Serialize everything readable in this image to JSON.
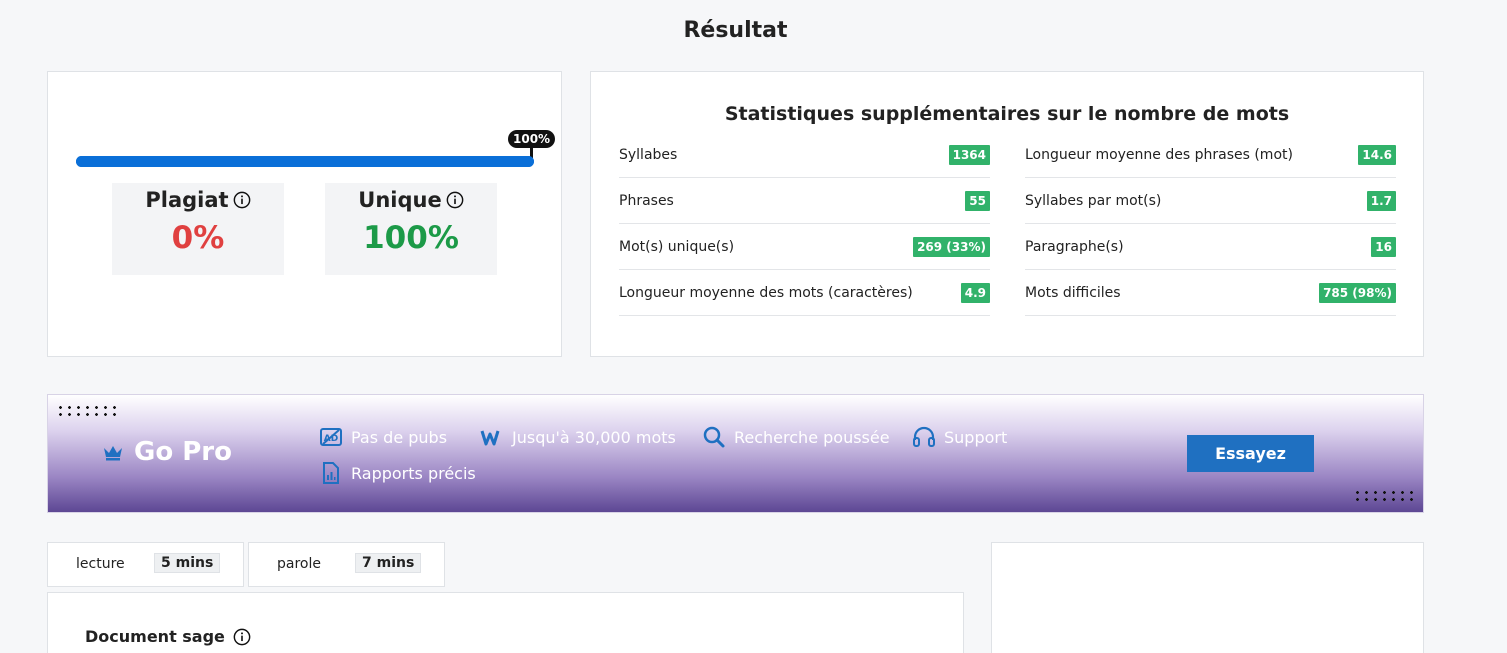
{
  "page": {
    "title": "Résultat"
  },
  "result": {
    "progress_label": "100%",
    "progress_fraction": 1.0,
    "plagiarism": {
      "label": "Plagiat",
      "value": "0%"
    },
    "unique": {
      "label": "Unique",
      "value": "100%"
    }
  },
  "stats": {
    "title": "Statistiques supplémentaires sur le nombre de mots",
    "left": [
      {
        "label": "Syllabes",
        "value": "1364"
      },
      {
        "label": "Phrases",
        "value": "55"
      },
      {
        "label": "Mot(s) unique(s)",
        "value": "269 (33%)"
      },
      {
        "label": "Longueur moyenne des mots (caractères)",
        "value": "4.9"
      }
    ],
    "right": [
      {
        "label": "Longueur moyenne des phrases (mot)",
        "value": "14.6"
      },
      {
        "label": "Syllabes par mot(s)",
        "value": "1.7"
      },
      {
        "label": "Paragraphe(s)",
        "value": "16"
      },
      {
        "label": "Mots difficiles",
        "value": "785 (98%)"
      }
    ],
    "badge_color": "#31b26a"
  },
  "promo": {
    "title": "Go Pro",
    "features": {
      "no_ads": "Pas de pubs",
      "words": "Jusqu'à 30,000 mots",
      "search": "Recherche poussée",
      "support": "Support",
      "reports": "Rapports précis"
    },
    "cta": "Essayez"
  },
  "reading": {
    "reading_label": "lecture",
    "reading_value": "5 mins",
    "speaking_label": "parole",
    "speaking_value": "7 mins"
  },
  "document": {
    "title": "Document sage"
  },
  "colors": {
    "accent": "#0a6fd8",
    "plagiarism": "#e04040",
    "unique": "#1c9a48",
    "cta": "#1f70c1"
  }
}
